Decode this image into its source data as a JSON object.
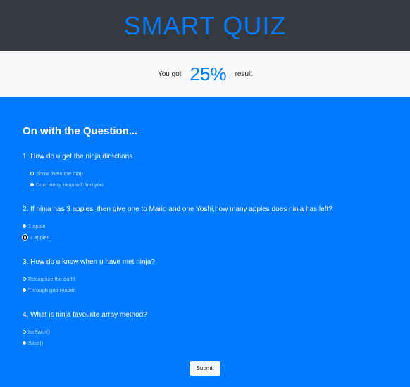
{
  "header": {
    "title": "SMART QUIZ"
  },
  "result": {
    "prefix": "You got",
    "percent": "25%",
    "suffix": "result"
  },
  "main": {
    "heading": "On with the Question..."
  },
  "questions": [
    {
      "title": "1. How do u get the ninja directions",
      "options": [
        {
          "label": "Show them the map",
          "checked": false
        },
        {
          "label": "Dont worry ninja will find you",
          "checked": true
        }
      ]
    },
    {
      "title": "2. If ninja has 3 apples, then give one to Mario and one Yoshi,how many apples does ninja has left?",
      "options": [
        {
          "label": "1 apple",
          "checked": true
        },
        {
          "label": "3 apples",
          "checked": true,
          "focused": true
        }
      ]
    },
    {
      "title": "3. How do u know when u have met ninja?",
      "options": [
        {
          "label": "Recognize the outfit",
          "checked": false
        },
        {
          "label": "Through grip reaper",
          "checked": true
        }
      ]
    },
    {
      "title": "4. What is ninja favourite array method?",
      "options": [
        {
          "label": "forEach()",
          "checked": false
        },
        {
          "label": "Slice()",
          "checked": true
        }
      ]
    }
  ],
  "submit": {
    "label": "Submit"
  },
  "colors": {
    "header_bg": "#343a40",
    "accent": "#007bff",
    "result_bg": "#f8f9fa"
  }
}
